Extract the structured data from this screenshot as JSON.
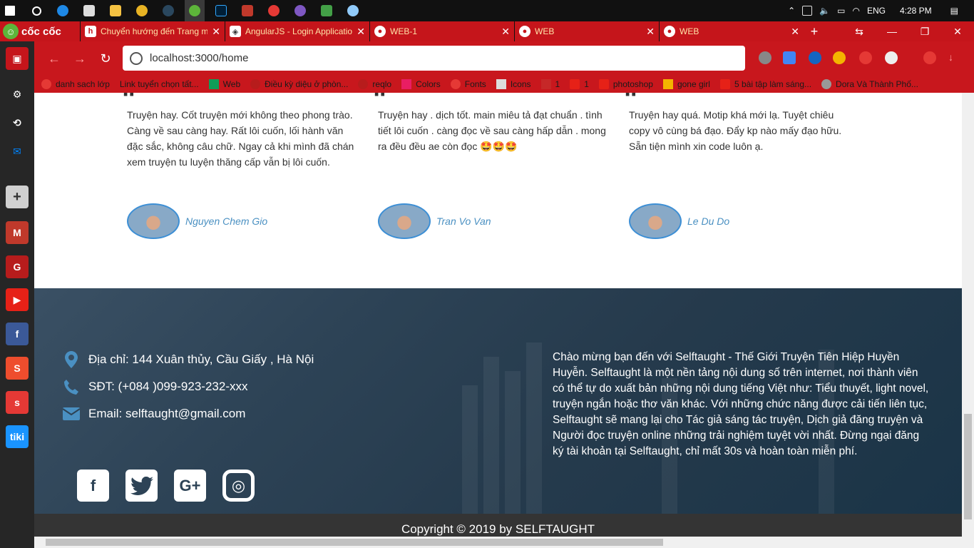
{
  "taskbar": {
    "time": "4:28 PM",
    "lang": "ENG"
  },
  "browser": {
    "brand": "cốc cốc",
    "tabs": [
      {
        "title": "Chuyển hướng đến Trang m",
        "favicon": "h"
      },
      {
        "title": "AngularJS - Login Applicatio",
        "favicon": ""
      },
      {
        "title": "WEB-1",
        "favicon": ""
      },
      {
        "title": "WEB",
        "favicon": ""
      },
      {
        "title": "WEB",
        "favicon": ""
      }
    ],
    "url": "localhost:3000/home",
    "bookmarks": [
      "danh sach lớp",
      "Link tuyển chọn tất...",
      "Web",
      "Điều kỳ diệu ở phòn...",
      "reqlo",
      "Colors",
      "Fonts",
      "Icons",
      "1",
      "1",
      "photoshop",
      "gone girl",
      "5 bài tập làm sáng...",
      "Dora Và Thành Phố..."
    ]
  },
  "testimonials": [
    {
      "text": "Truyện hay. Cốt truyện mới không theo phong trào. Càng về sau càng hay. Rất lôi cuốn, lối hành văn đặc sắc, không câu chữ. Ngay cả khi mình đã chán xem truyện tu luyện thăng cấp vẫn bị lôi cuốn.",
      "author": "Nguyen Chem Gio"
    },
    {
      "text": "Truyện hay . dịch tốt. main miêu tả đạt chuẩn . tình tiết lôi cuốn . càng đọc về sau càng hấp dẫn . mong ra đều đều ae còn đọc 🤩🤩🤩",
      "author": "Tran Vo Van"
    },
    {
      "text": "Truyện hay quá. Motip khá mới lạ. Tuyệt chiêu copy vô cùng bá đạo. Đẩy kp nào mấy đạo hữu. Sẵn tiện mình xin code luôn ạ.",
      "author": "Le Du Do"
    }
  ],
  "footer": {
    "address": "Địa chỉ: 144 Xuân thủy, Cầu Giấy , Hà Nội",
    "phone": "SĐT: (+084 )099-923-232-xxx",
    "email": "Email: selftaught@gmail.com",
    "about": "Chào mừng bạn đến với Selftaught - Thế Giới Truyện Tiên Hiệp Huyền Huyễn. Selftaught là một nền tảng nội dung số trên internet, nơi thành viên có thể tự do xuất bản những nội dung tiếng Việt như: Tiểu thuyết, light novel, truyện ngắn hoặc thơ văn khác. Với những chức năng được cải tiến liên tục, Selftaught sẽ mang lại cho Tác giả sáng tác truyện, Dịch giả đăng truyện và Người đọc truyện online những trải nghiệm tuyệt vời nhất. Đừng ngại đăng ký tài khoản tại Selftaught, chỉ mất 30s và hoàn toàn miễn phí.",
    "social": {
      "facebook": "f",
      "twitter": "t",
      "googleplus": "G+",
      "instagram": "◎"
    },
    "copyright": "Copyright © 2019 by SELFTAUGHT"
  },
  "colors": {
    "browser_red": "#c8171d",
    "link_blue": "#4a90c2",
    "footer_bg": "#2d4356",
    "copyright_bg": "#343434"
  }
}
